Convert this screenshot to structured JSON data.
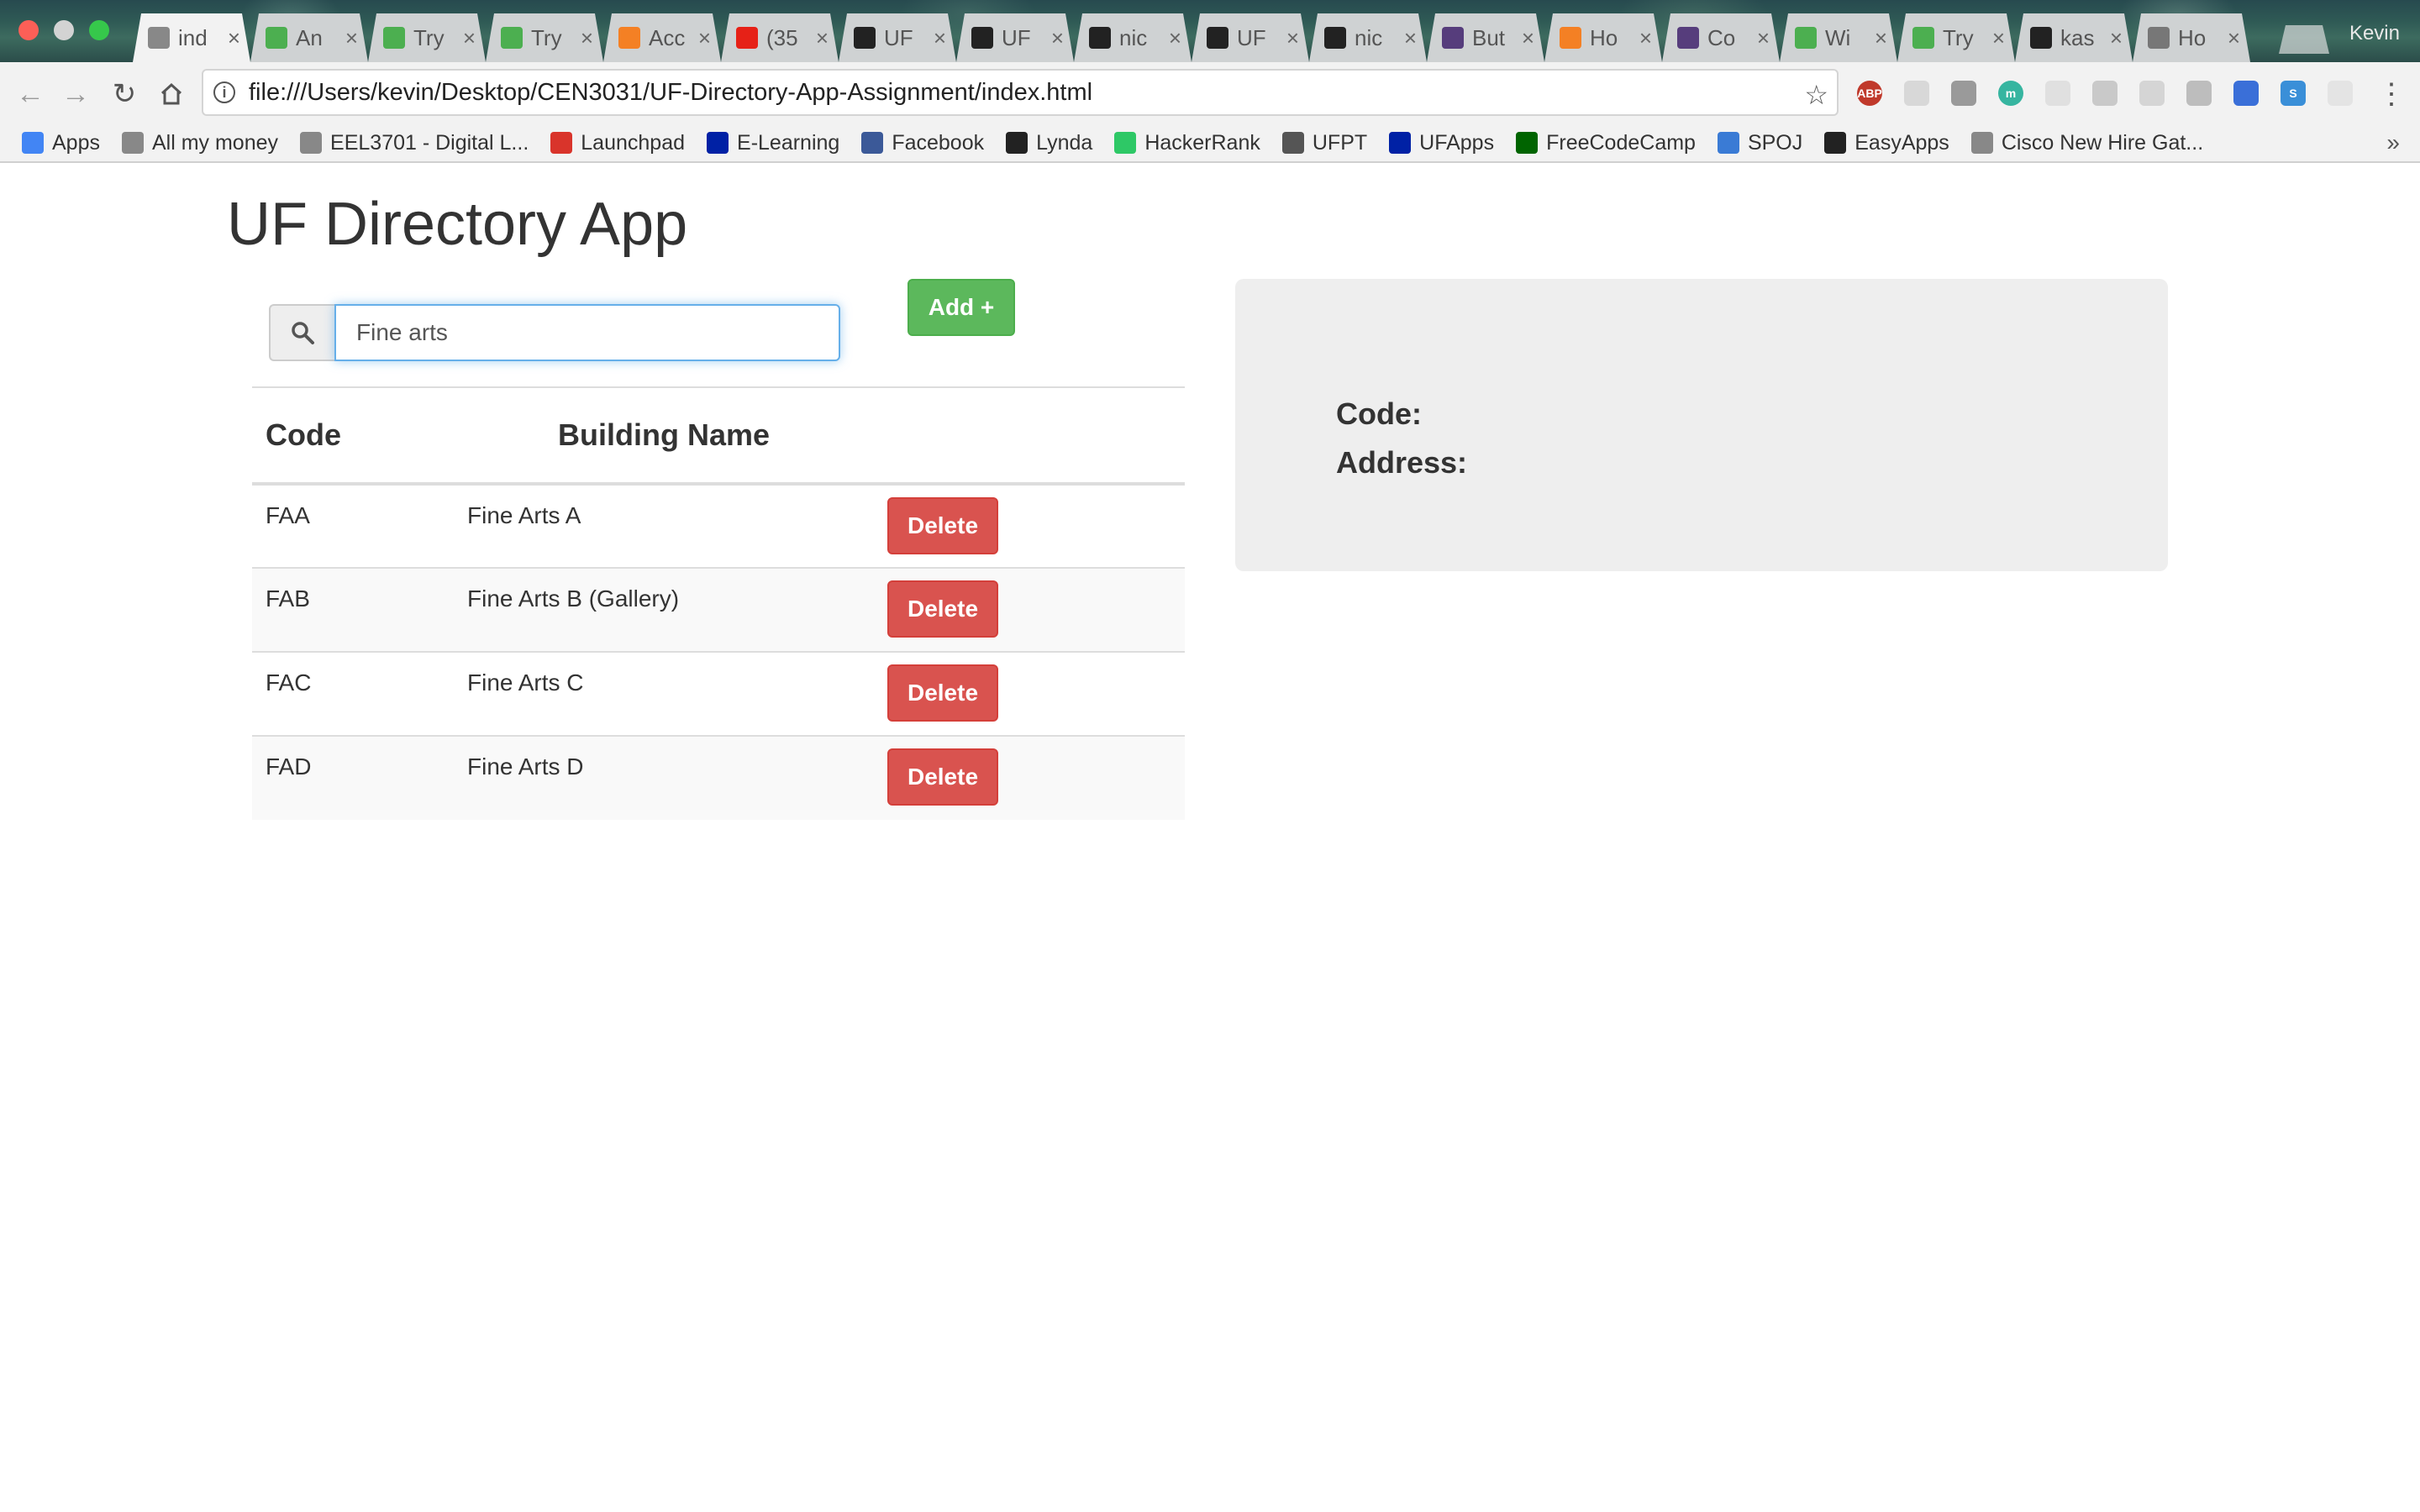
{
  "browser": {
    "tabs": [
      {
        "label": "ind",
        "favicon": "document-icon",
        "color": "#888888",
        "active": true
      },
      {
        "label": "An",
        "favicon": "w3schools-icon",
        "color": "#4caf50"
      },
      {
        "label": "Try",
        "favicon": "w3schools-icon",
        "color": "#4caf50"
      },
      {
        "label": "Try",
        "favicon": "w3schools-icon",
        "color": "#4caf50"
      },
      {
        "label": "Acc",
        "favicon": "stackoverflow-icon",
        "color": "#f48024"
      },
      {
        "label": "(35",
        "favicon": "youtube-icon",
        "color": "#e62117"
      },
      {
        "label": "UF",
        "favicon": "github-icon",
        "color": "#222222"
      },
      {
        "label": "UF",
        "favicon": "github-icon",
        "color": "#222222"
      },
      {
        "label": "nic",
        "favicon": "github-icon",
        "color": "#222222"
      },
      {
        "label": "UF",
        "favicon": "github-icon",
        "color": "#222222"
      },
      {
        "label": "nic",
        "favicon": "github-icon",
        "color": "#222222"
      },
      {
        "label": "But",
        "favicon": "bootstrap-icon",
        "color": "#563d7c"
      },
      {
        "label": "Ho",
        "favicon": "stackoverflow-icon",
        "color": "#f48024"
      },
      {
        "label": "Co",
        "favicon": "bootstrap-icon",
        "color": "#563d7c"
      },
      {
        "label": "Wi",
        "favicon": "w3schools-icon",
        "color": "#4caf50"
      },
      {
        "label": "Try",
        "favicon": "w3schools-icon",
        "color": "#4caf50"
      },
      {
        "label": "kas",
        "favicon": "github-icon",
        "color": "#222222"
      },
      {
        "label": "Ho",
        "favicon": "apple-icon",
        "color": "#777777"
      }
    ],
    "profile_name": "Kevin",
    "url": "file:///Users/kevin/Desktop/CEN3031/UF-Directory-App-Assignment/index.html",
    "bookmarks": [
      {
        "label": "Apps",
        "icon": "apps-grid-icon",
        "color": "#4285f4"
      },
      {
        "label": "All my money",
        "icon": "folder-icon",
        "color": "#888888"
      },
      {
        "label": "EEL3701 - Digital L...",
        "icon": "page-icon",
        "color": "#888888"
      },
      {
        "label": "Launchpad",
        "icon": "launchpad-icon",
        "color": "#d9342b"
      },
      {
        "label": "E-Learning",
        "icon": "uf-icon",
        "color": "#0021a5"
      },
      {
        "label": "Facebook",
        "icon": "facebook-icon",
        "color": "#3b5998"
      },
      {
        "label": "Lynda",
        "icon": "lynda-icon",
        "color": "#222222"
      },
      {
        "label": "HackerRank",
        "icon": "hackerrank-icon",
        "color": "#2ec866"
      },
      {
        "label": "UFPT",
        "icon": "ufpt-icon",
        "color": "#555555"
      },
      {
        "label": "UFApps",
        "icon": "uf-icon",
        "color": "#0021a5"
      },
      {
        "label": "FreeCodeCamp",
        "icon": "freecodecamp-icon",
        "color": "#006400"
      },
      {
        "label": "SPOJ",
        "icon": "spoj-icon",
        "color": "#3a7bd5"
      },
      {
        "label": "EasyApps",
        "icon": "github-icon",
        "color": "#222222"
      },
      {
        "label": "Cisco New Hire Gat...",
        "icon": "page-icon",
        "color": "#888888"
      }
    ]
  },
  "app": {
    "title": "UF Directory App",
    "search": {
      "value": "Fine arts",
      "placeholder": ""
    },
    "add_label": "Add +",
    "table": {
      "headers": {
        "code": "Code",
        "name": "Building Name"
      },
      "rows": [
        {
          "code": "FAA",
          "name": "Fine Arts A",
          "action": "Delete"
        },
        {
          "code": "FAB",
          "name": "Fine Arts B (Gallery)",
          "action": "Delete"
        },
        {
          "code": "FAC",
          "name": "Fine Arts C",
          "action": "Delete"
        },
        {
          "code": "FAD",
          "name": "Fine Arts D",
          "action": "Delete"
        }
      ]
    },
    "details": {
      "code_label": "Code:",
      "address_label": "Address:"
    }
  },
  "colors": {
    "add_button": "#5cb85c",
    "delete_button": "#d9534f",
    "details_panel": "#eeeeee",
    "input_focus": "#66afe9"
  }
}
